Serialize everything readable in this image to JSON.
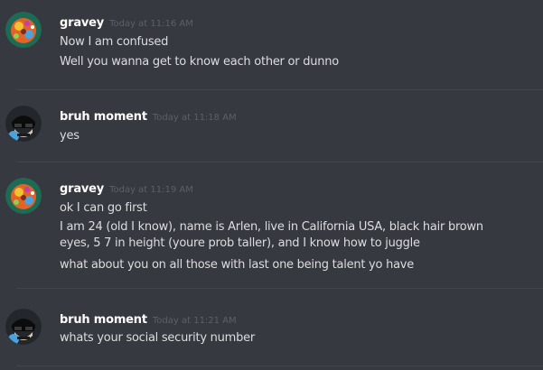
{
  "messages": [
    {
      "username": "gravey",
      "timestamp": "Today at 11:16 AM",
      "lines": [
        "Now I am confused",
        "Well you wanna get to know each other or dunno"
      ]
    },
    {
      "username": "bruh moment",
      "timestamp": "Today at 11:18 AM",
      "lines": [
        "yes"
      ]
    },
    {
      "username": "gravey",
      "timestamp": "Today at 11:19 AM",
      "lines": [
        "ok I can go first",
        "I am 24 (old I know), name is Arlen, live in California USA, black hair brown",
        "eyes, 5 7 in height (youre prob taller), and I know how to juggle",
        "what about you on all those with last one being talent yo have"
      ]
    },
    {
      "username": "bruh moment",
      "timestamp": "Today at 11:21 AM",
      "lines": [
        "whats your social security number"
      ]
    }
  ],
  "colors": {
    "background": "#36393f",
    "divider": "#42454a",
    "username": "#ffffff",
    "timestamp": "#5d6067",
    "message_text": "#dcddde"
  },
  "icons": {
    "gravey_avatar": "colorful-planet-avatar-icon",
    "bruh_avatar": "sunglasses-face-avatar-icon"
  }
}
